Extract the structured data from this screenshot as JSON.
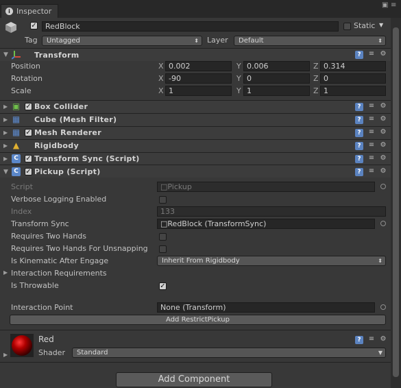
{
  "window": {
    "tab_label": "Inspector"
  },
  "header": {
    "object_name": "RedBlock",
    "static_label": "Static",
    "tag_label": "Tag",
    "tag_value": "Untagged",
    "layer_label": "Layer",
    "layer_value": "Default"
  },
  "transform": {
    "title": "Transform",
    "rows": [
      {
        "label": "Position",
        "x": "0.002",
        "y": "0.006",
        "z": "0.314"
      },
      {
        "label": "Rotation",
        "x": "-90",
        "y": "0",
        "z": "0"
      },
      {
        "label": "Scale",
        "x": "1",
        "y": "1",
        "z": "1"
      }
    ],
    "axis_x": "X",
    "axis_y": "Y",
    "axis_z": "Z"
  },
  "components": [
    {
      "title": "Box Collider",
      "checkbox": true
    },
    {
      "title": "Cube (Mesh Filter)",
      "checkbox": false
    },
    {
      "title": "Mesh Renderer",
      "checkbox": true
    },
    {
      "title": "Rigidbody",
      "checkbox": false
    },
    {
      "title": "Transform Sync (Script)",
      "checkbox": true
    }
  ],
  "pickup": {
    "title": "Pickup (Script)",
    "script_label": "Script",
    "script_value": "Pickup",
    "verbose_label": "Verbose Logging Enabled",
    "index_label": "Index",
    "index_value": "133",
    "transform_sync_label": "Transform Sync",
    "transform_sync_value": "RedBlock (TransformSync)",
    "two_hands_label": "Requires Two Hands",
    "two_hands_unsnap_label": "Requires Two Hands For Unsnapping",
    "kinematic_label": "Is Kinematic After Engage",
    "kinematic_value": "Inherit From Rigidbody",
    "interaction_req_label": "Interaction Requirements",
    "throwable_label": "Is Throwable",
    "interaction_point_label": "Interaction Point",
    "interaction_point_value": "None (Transform)",
    "add_restrict_button": "Add RestrictPickup"
  },
  "material": {
    "name": "Red",
    "shader_label": "Shader",
    "shader_value": "Standard"
  },
  "add_component_button": "Add Component",
  "colors": {
    "background": "#383838",
    "accent_help": "#5b83c0",
    "material_red": "#b00000"
  }
}
